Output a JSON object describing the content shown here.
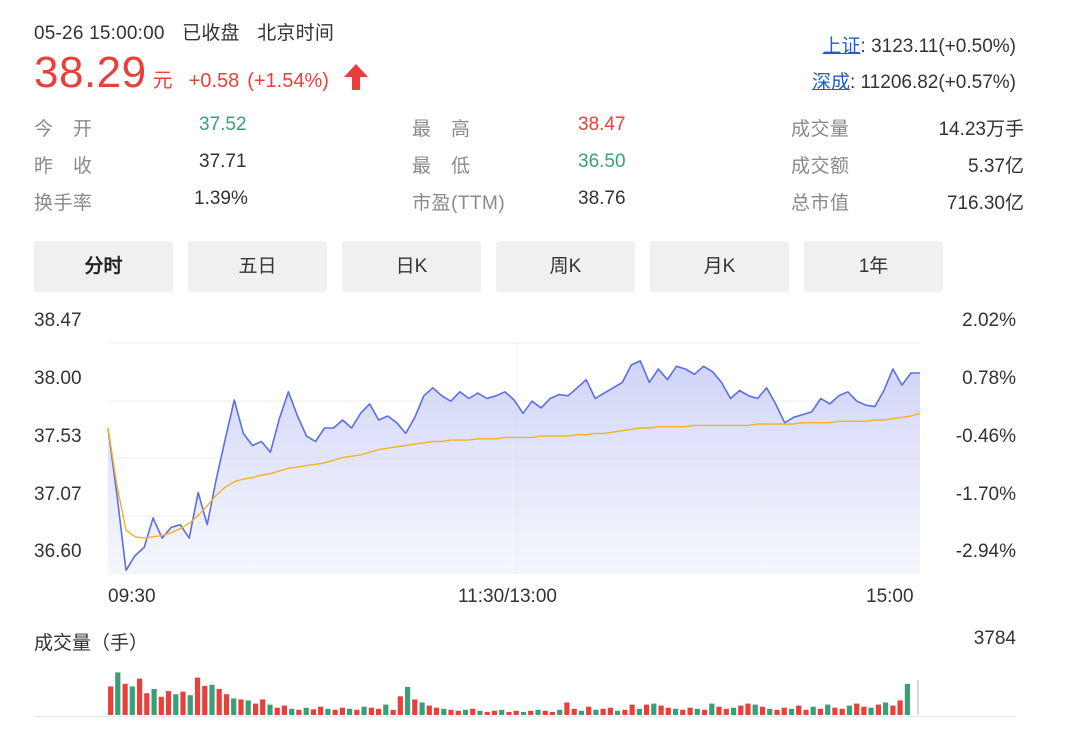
{
  "header": {
    "date": "05-26 15:00:00",
    "status": "已收盘",
    "timezone": "北京时间"
  },
  "quote": {
    "price": "38.29",
    "unit": "元",
    "change": "+0.58",
    "change_pct": "(+1.54%)",
    "direction_icon": "arrow-up-icon",
    "up_color": "#e8403a",
    "down_color": "#3c9e78"
  },
  "indices": [
    {
      "label": "上证",
      "value": ": 3123.11(+0.50%)"
    },
    {
      "label": "深成",
      "value": ": 11206.82(+0.57%)"
    }
  ],
  "stats": [
    [
      {
        "label": "今　开",
        "value": "37.52",
        "color": "green"
      },
      {
        "label": "最　高",
        "value": "38.47",
        "color": "red"
      },
      {
        "label": "成交量",
        "value": "14.23万手",
        "color": "plain"
      }
    ],
    [
      {
        "label": "昨　收",
        "value": "37.71",
        "color": "plain"
      },
      {
        "label": "最　低",
        "value": "36.50",
        "color": "green"
      },
      {
        "label": "成交额",
        "value": "5.37亿",
        "color": "plain"
      }
    ],
    [
      {
        "label": "换手率",
        "value": "1.39%",
        "color": "plain"
      },
      {
        "label": "市盈(TTM)",
        "value": "38.76",
        "color": "plain"
      },
      {
        "label": "总市值",
        "value": "716.30亿",
        "color": "plain"
      }
    ]
  ],
  "tabs": [
    {
      "label": "分时",
      "active": true
    },
    {
      "label": "五日",
      "active": false
    },
    {
      "label": "日K",
      "active": false
    },
    {
      "label": "周K",
      "active": false
    },
    {
      "label": "月K",
      "active": false
    },
    {
      "label": "1年",
      "active": false
    }
  ],
  "chart_data": {
    "type": "line",
    "y_left_ticks": [
      "38.47",
      "38.00",
      "37.53",
      "37.07",
      "36.60"
    ],
    "y_right_ticks": [
      "2.02%",
      "0.78%",
      "-0.46%",
      "-1.70%",
      "-2.94%"
    ],
    "x_ticks": [
      "09:30",
      "11:30/13:00",
      "15:00"
    ],
    "ylim": [
      36.6,
      38.47
    ],
    "series": [
      {
        "color": "#5b6ee6",
        "values": [
          37.68,
          37.18,
          36.62,
          36.73,
          36.79,
          37.01,
          36.86,
          36.94,
          36.96,
          36.86,
          37.2,
          36.96,
          37.3,
          37.6,
          37.89,
          37.64,
          37.55,
          37.58,
          37.5,
          37.75,
          37.95,
          37.77,
          37.62,
          37.58,
          37.68,
          37.68,
          37.74,
          37.68,
          37.79,
          37.86,
          37.74,
          37.77,
          37.72,
          37.64,
          37.76,
          37.92,
          37.98,
          37.92,
          37.88,
          37.95,
          37.9,
          37.94,
          37.9,
          37.92,
          37.95,
          37.89,
          37.79,
          37.88,
          37.83,
          37.9,
          37.93,
          37.92,
          37.98,
          38.04,
          37.9,
          37.94,
          37.98,
          38.02,
          38.15,
          38.18,
          38.02,
          38.12,
          38.04,
          38.14,
          38.12,
          38.08,
          38.14,
          38.1,
          38.02,
          37.9,
          37.96,
          37.92,
          37.9,
          37.98,
          37.86,
          37.72,
          37.76,
          37.78,
          37.8,
          37.9,
          37.86,
          37.92,
          37.95,
          37.88,
          37.85,
          37.84,
          37.96,
          38.12,
          38.0,
          38.09,
          38.09
        ]
      },
      {
        "color": "#f0b323",
        "values": [
          37.68,
          37.25,
          36.92,
          36.87,
          36.86,
          36.87,
          36.88,
          36.9,
          36.93,
          36.97,
          37.03,
          37.1,
          37.18,
          37.24,
          37.28,
          37.3,
          37.31,
          37.33,
          37.34,
          37.36,
          37.38,
          37.39,
          37.4,
          37.41,
          37.42,
          37.44,
          37.46,
          37.47,
          37.48,
          37.5,
          37.52,
          37.53,
          37.54,
          37.55,
          37.56,
          37.57,
          37.58,
          37.58,
          37.59,
          37.59,
          37.59,
          37.6,
          37.6,
          37.6,
          37.61,
          37.61,
          37.61,
          37.61,
          37.62,
          37.62,
          37.62,
          37.62,
          37.63,
          37.63,
          37.64,
          37.64,
          37.65,
          37.66,
          37.67,
          37.68,
          37.68,
          37.69,
          37.69,
          37.69,
          37.69,
          37.7,
          37.7,
          37.7,
          37.7,
          37.7,
          37.7,
          37.7,
          37.71,
          37.71,
          37.71,
          37.71,
          37.71,
          37.72,
          37.72,
          37.72,
          37.72,
          37.73,
          37.73,
          37.73,
          37.73,
          37.74,
          37.74,
          37.75,
          37.76,
          37.77,
          37.79
        ]
      }
    ]
  },
  "volume": {
    "title": "成交量（手）",
    "max_label": "3784",
    "values": [
      0.55,
      0.82,
      0.6,
      0.55,
      0.7,
      0.42,
      0.5,
      0.35,
      0.46,
      0.4,
      0.45,
      0.38,
      0.72,
      0.56,
      0.58,
      0.5,
      0.4,
      0.32,
      0.3,
      0.28,
      0.22,
      0.3,
      0.2,
      0.14,
      0.18,
      0.12,
      0.1,
      0.14,
      0.11,
      0.16,
      0.12,
      0.1,
      0.14,
      0.12,
      0.1,
      0.16,
      0.14,
      0.12,
      0.2,
      0.1,
      0.36,
      0.54,
      0.3,
      0.24,
      0.18,
      0.14,
      0.12,
      0.1,
      0.08,
      0.1,
      0.12,
      0.08,
      0.06,
      0.08,
      0.1,
      0.06,
      0.08,
      0.06,
      0.08,
      0.1,
      0.08,
      0.06,
      0.1,
      0.24,
      0.12,
      0.08,
      0.16,
      0.1,
      0.12,
      0.14,
      0.08,
      0.1,
      0.2,
      0.12,
      0.2,
      0.22,
      0.18,
      0.14,
      0.12,
      0.1,
      0.14,
      0.12,
      0.1,
      0.22,
      0.16,
      0.12,
      0.14,
      0.18,
      0.22,
      0.2,
      0.16,
      0.12,
      0.1,
      0.14,
      0.12,
      0.18,
      0.1,
      0.16,
      0.12,
      0.2,
      0.14,
      0.12,
      0.18,
      0.22,
      0.16,
      0.14,
      0.2,
      0.24,
      0.18,
      0.28,
      0.6
    ],
    "colors": [
      "#e8403a",
      "#3c9e78",
      "#e8403a",
      "#3c9e78",
      "#e8403a",
      "#e8403a",
      "#3c9e78",
      "#e8403a"
    ]
  }
}
